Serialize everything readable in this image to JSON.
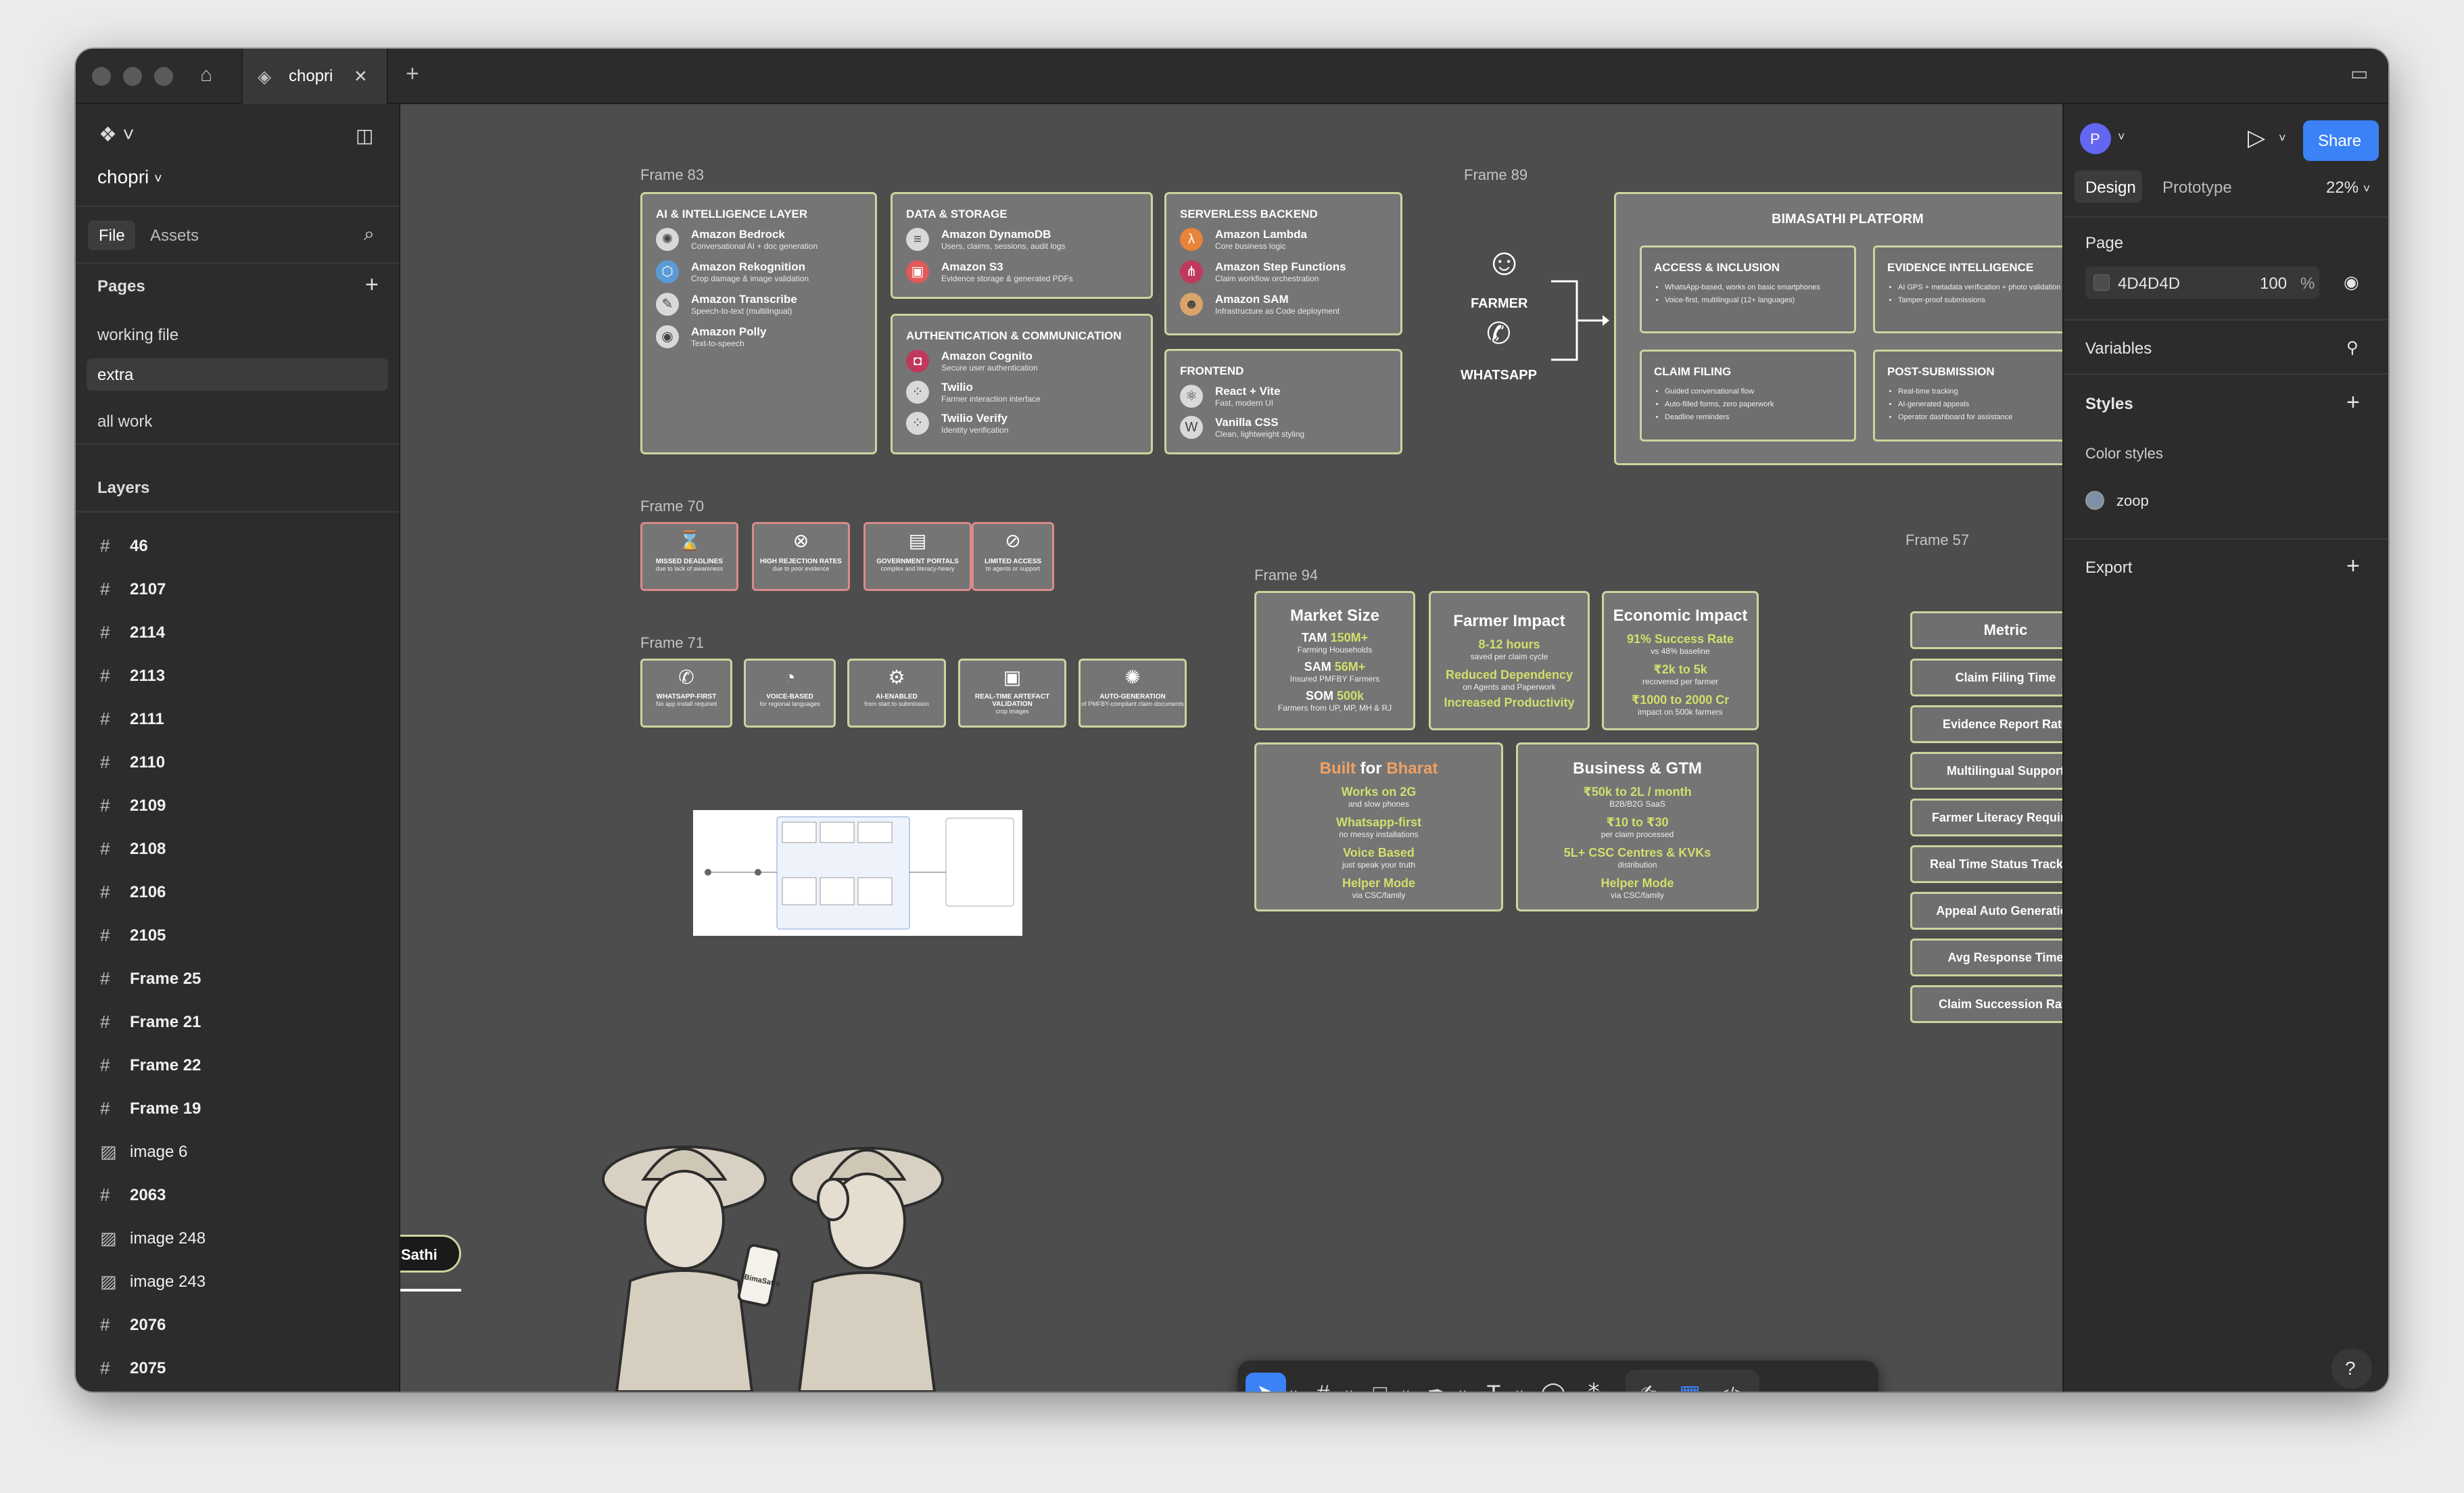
{
  "tabbar": {
    "doc_tab": "chopri"
  },
  "left": {
    "file_name": "chopri",
    "tabs": [
      "File",
      "Assets"
    ],
    "pages_title": "Pages",
    "pages": [
      "working file",
      "extra",
      "all work"
    ],
    "layers_title": "Layers",
    "layers": [
      {
        "name": "46",
        "icon": "frame-icon"
      },
      {
        "name": "2107",
        "icon": "frame-icon"
      },
      {
        "name": "2114",
        "icon": "frame-icon"
      },
      {
        "name": "2113",
        "icon": "frame-icon"
      },
      {
        "name": "2111",
        "icon": "frame-icon"
      },
      {
        "name": "2110",
        "icon": "frame-icon"
      },
      {
        "name": "2109",
        "icon": "frame-icon"
      },
      {
        "name": "2108",
        "icon": "frame-icon"
      },
      {
        "name": "2106",
        "icon": "frame-icon"
      },
      {
        "name": "2105",
        "icon": "frame-icon"
      },
      {
        "name": "Frame 25",
        "icon": "frame-icon"
      },
      {
        "name": "Frame 21",
        "icon": "frame-icon"
      },
      {
        "name": "Frame 22",
        "icon": "frame-icon"
      },
      {
        "name": "Frame 19",
        "icon": "frame-icon"
      },
      {
        "name": "image 6",
        "icon": "image-icon"
      },
      {
        "name": "2063",
        "icon": "frame-icon"
      },
      {
        "name": "image 248",
        "icon": "image-icon"
      },
      {
        "name": "image 243",
        "icon": "image-icon"
      },
      {
        "name": "2076",
        "icon": "frame-icon"
      },
      {
        "name": "2075",
        "icon": "frame-icon"
      }
    ]
  },
  "right": {
    "avatar": "P",
    "share": "Share",
    "tabs": [
      "Design",
      "Prototype"
    ],
    "zoom": "22%",
    "page_title": "Page",
    "page_color": "4D4D4D",
    "page_opacity": "100",
    "percent": "%",
    "variables": "Variables",
    "styles": "Styles",
    "color_styles": "Color styles",
    "color_style_name": "zoop",
    "export": "Export",
    "help": "?"
  },
  "canvas": {
    "frame83": {
      "label": "Frame 83",
      "ai": {
        "title": "AI & INTELLIGENCE LAYER",
        "items": [
          {
            "n": "Amazon Bedrock",
            "d": "Conversational AI + doc generation"
          },
          {
            "n": "Amazon Rekognition",
            "d": "Crop damage & image validation"
          },
          {
            "n": "Amazon Transcribe",
            "d": "Speech-to-text (multilingual)"
          },
          {
            "n": "Amazon Polly",
            "d": "Text-to-speech"
          }
        ]
      },
      "data": {
        "title": "DATA & STORAGE",
        "items": [
          {
            "n": "Amazon DynamoDB",
            "d": "Users, claims, sessions, audit logs"
          },
          {
            "n": "Amazon S3",
            "d": "Evidence storage & generated PDFs"
          }
        ]
      },
      "auth": {
        "title": "AUTHENTICATION & COMMUNICATION",
        "items": [
          {
            "n": "Amazon Cognito",
            "d": "Secure user authentication"
          },
          {
            "n": "Twilio",
            "d": "Farmer interaction interface"
          },
          {
            "n": "Twilio Verify",
            "d": "Identity verification"
          }
        ]
      },
      "serverless": {
        "title": "SERVERLESS BACKEND",
        "items": [
          {
            "n": "Amazon Lambda",
            "d": "Core business logic"
          },
          {
            "n": "Amazon Step Functions",
            "d": "Claim workflow orchestration"
          },
          {
            "n": "Amazon SAM",
            "d": "Infrastructure as Code deployment"
          }
        ]
      },
      "frontend": {
        "title": "FRONTEND",
        "items": [
          {
            "n": "React + Vite",
            "d": "Fast, modern UI"
          },
          {
            "n": "Vanilla CSS",
            "d": "Clean, lightweight styling"
          }
        ]
      }
    },
    "frame89": {
      "label": "Frame 89",
      "farmer": "FARMER",
      "whatsapp": "WHATSAPP",
      "platform": "BIMASATHI PLATFORM",
      "cards": [
        {
          "t": "ACCESS & INCLUSION",
          "b": [
            "WhatsApp-based, works on basic smartphones",
            "Voice-first, multilingual (12+ languages)"
          ]
        },
        {
          "t": "EVIDENCE INTELLIGENCE",
          "b": [
            "AI GPS + metadata verification + photo validation",
            "Tamper-proof submissions"
          ]
        },
        {
          "t": "CLAIM FILING",
          "b": [
            "Guided conversational flow",
            "Auto-filled forms, zero paperwork",
            "Deadline reminders"
          ]
        },
        {
          "t": "POST-SUBMISSION",
          "b": [
            "Real-time tracking",
            "AI-generated appeals",
            "Operator dashboard for assistance"
          ]
        }
      ]
    },
    "frame70": {
      "label": "Frame 70",
      "items": [
        {
          "t": "MISSED DEADLINES",
          "s": "due to lack of awareness"
        },
        {
          "t": "HIGH REJECTION RATES",
          "s": "due to poor evidence"
        },
        {
          "t": "GOVERNMENT PORTALS",
          "s": "complex and literacy-heavy"
        },
        {
          "t": "LIMITED ACCESS",
          "s": "to agents or support"
        }
      ]
    },
    "frame71": {
      "label": "Frame 71",
      "items": [
        {
          "t": "WHATSAPP-FIRST",
          "s": "No app install required"
        },
        {
          "t": "VOICE-BASED",
          "s": "for regional languages"
        },
        {
          "t": "AI-ENABLED",
          "s": "from start to submission"
        },
        {
          "t": "REAL-TIME ARTEFACT VALIDATION",
          "s": "crop images"
        },
        {
          "t": "AUTO-GENERATION",
          "s": "of PMFBY-compliant claim documents"
        }
      ]
    },
    "frame94": {
      "label": "Frame 94",
      "market": {
        "title": "Market Size",
        "tam_k": "TAM",
        "tam_v": "150M+",
        "tam_s": "Farming Households",
        "sam_k": "SAM",
        "sam_v": "56M+",
        "sam_s": "Insured PMFBY Farmers",
        "som_k": "SOM",
        "som_v": "500k",
        "som_s": "Farmers from UP, MP, MH & RJ"
      },
      "farmer": {
        "title": "Farmer Impact",
        "a": "8-12 hours",
        "as": "saved per claim cycle",
        "b": "Reduced Dependency",
        "bs": "on Agents and Paperwork",
        "c": "Increased Productivity"
      },
      "econ": {
        "title": "Economic Impact",
        "a": "91% Success Rate",
        "as": "vs 48% baseline",
        "b": "₹2k to 5k",
        "bs": "recovered per farmer",
        "c": "₹1000 to 2000 Cr",
        "cs": "impact on 500k farmers"
      },
      "built": {
        "t1": "Built",
        "t2": "for",
        "t3": "Bharat",
        "a": "Works on 2G",
        "as": "and slow phones",
        "b": "Whatsapp-first",
        "bs": "no messy installations",
        "c": "Voice Based",
        "cs": "just speak your truth",
        "d": "Helper Mode",
        "ds": "via CSC/family"
      },
      "biz": {
        "title": "Business & GTM",
        "a": "₹50k to 2L / month",
        "as": "B2B/B2G SaaS",
        "b": "₹10 to ₹30",
        "bs": "per claim processed",
        "c": "5L+ CSC Centres & KVKs",
        "cs": "distribution",
        "d": "Helper Mode",
        "ds": "via CSC/family"
      }
    },
    "frame57": {
      "label": "Frame 57",
      "header": "Metric",
      "rows": [
        "Claim Filing Time",
        "Evidence Report Rate",
        "Multilingual Support",
        "Farmer Literacy Required",
        "Real Time Status Tracking",
        "Appeal Auto Generation",
        "Avg Response Time",
        "Claim Succession Rate"
      ]
    },
    "pill": "Sathi",
    "phone_text": "BimaSathi"
  },
  "colors": {
    "accent": "#3b82f6",
    "card_border": "#cfd39e",
    "problem_border": "#d98b8b",
    "highlight": "#d2df6c",
    "orange": "#f0a064"
  }
}
